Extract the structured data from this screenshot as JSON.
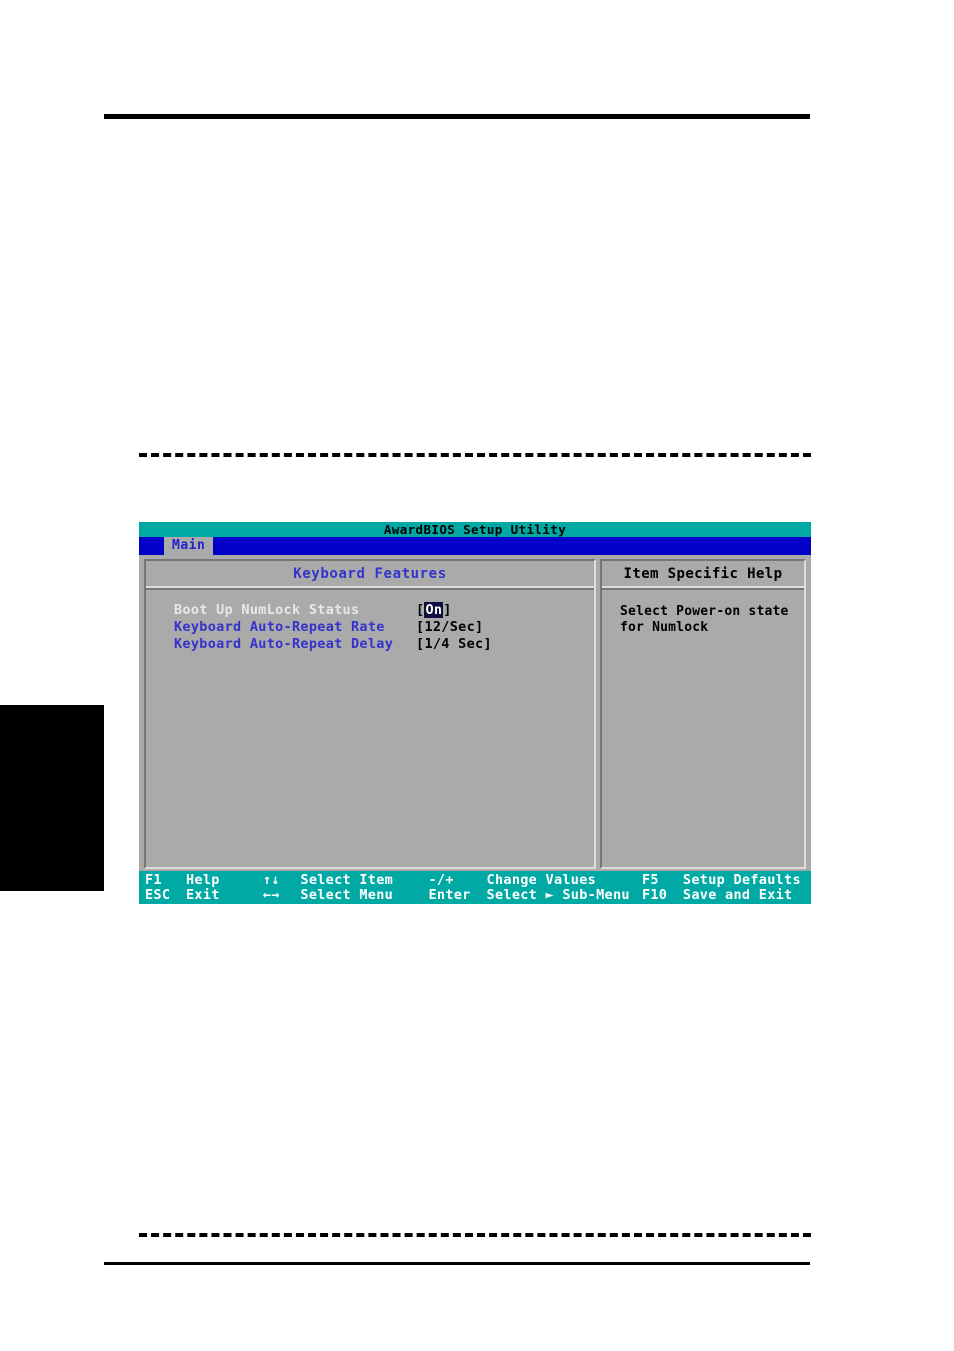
{
  "page": {
    "rules": {
      "top": true,
      "bottom": true,
      "dashed_top": true,
      "dashed_bottom": true
    },
    "edge_tab": {
      "label": ""
    }
  },
  "bios": {
    "title": "AwardBIOS Setup Utility",
    "menu": {
      "tabs": [
        {
          "label": "Main",
          "active": true
        }
      ]
    },
    "left_pane": {
      "heading": "Keyboard Features",
      "settings": [
        {
          "label": "Boot Up NumLock Status",
          "value_prefix": "[",
          "value": "On",
          "value_suffix": "]",
          "selected": true
        },
        {
          "label": "Keyboard Auto-Repeat Rate",
          "value_prefix": "[",
          "value": "12/Sec",
          "value_suffix": "]",
          "selected": false
        },
        {
          "label": "Keyboard Auto-Repeat Delay",
          "value_prefix": "[",
          "value": "1/4 Sec",
          "value_suffix": "]",
          "selected": false
        }
      ]
    },
    "right_pane": {
      "heading": "Item Specific Help",
      "help_lines": [
        "Select Power-on state",
        "for Numlock"
      ]
    },
    "footer": {
      "row1": [
        {
          "key": "F1",
          "action": "Help"
        },
        {
          "key": "↑↓",
          "action": "Select Item"
        },
        {
          "key": "-/+",
          "action": "Change Values"
        },
        {
          "key": "F5",
          "action": "Setup Defaults"
        }
      ],
      "row2": [
        {
          "key": "ESC",
          "action": "Exit"
        },
        {
          "key": "←→",
          "action": "Select Menu"
        },
        {
          "key": "Enter",
          "action": "Select ► Sub-Menu"
        },
        {
          "key": "F10",
          "action": "Save and Exit"
        }
      ]
    },
    "colors": {
      "title_bar": "#00a9a3",
      "menu_bar": "#0000c8",
      "panel_bg": "#aaaaaa",
      "label_blue": "#3333cc",
      "selected_label": "#e8e8e8",
      "highlight_bg": "#101040",
      "footer_bg": "#00a9a3"
    }
  }
}
